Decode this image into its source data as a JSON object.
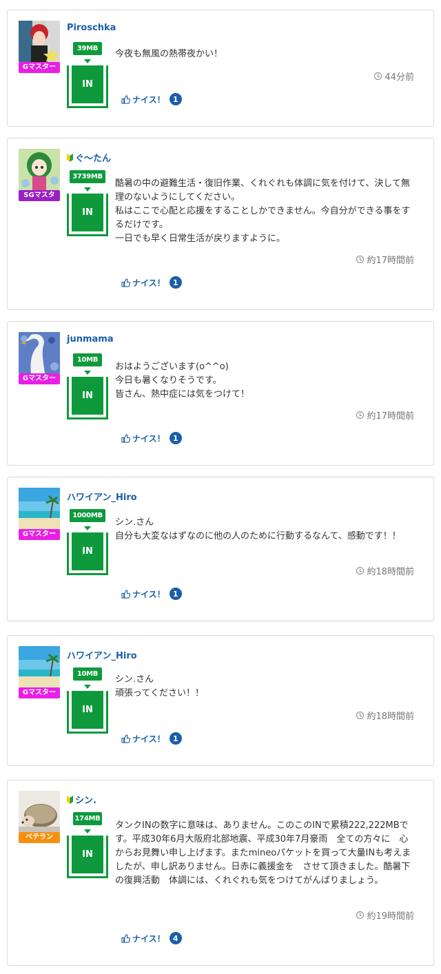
{
  "colors": {
    "tank_green": "#0e9a3c",
    "link_blue": "#1a5fa8",
    "rank_gmaster": "#e91fe6",
    "rank_sgmaster": "#9b1fc4",
    "rank_veteran": "#f5900f"
  },
  "posts": [
    {
      "user": "Piroschka",
      "beginner_mark": false,
      "rank": "Gマスター",
      "tank_amount": "39MB",
      "tank_label": "IN",
      "text": "今夜も無風の熱帯夜かい！",
      "time": "44分前",
      "nice_label": "ナイス！",
      "nice_count": "1"
    },
    {
      "user": "ぐ〜たん",
      "beginner_mark": true,
      "rank": "SGマスタ",
      "tank_amount": "3739MB",
      "tank_label": "IN",
      "text": "酷暑の中の避難生活・復旧作業、くれぐれも体調に気を付けて、決して無理のないようにしてください。\n私はここで心配と応援をすることしかできません。今自分ができる事をするだけです。\n一日でも早く日常生活が戻りますように。",
      "time": "約17時間前",
      "nice_label": "ナイス！",
      "nice_count": "1"
    },
    {
      "user": "junmama",
      "beginner_mark": false,
      "rank": "Gマスター",
      "tank_amount": "10MB",
      "tank_label": "IN",
      "text": "おはようございます(o^^o)\n今日も暑くなりそうです。\n皆さん、熱中症には気をつけて！",
      "time": "約17時間前",
      "nice_label": "ナイス！",
      "nice_count": "1"
    },
    {
      "user": "ハワイアン_Hiro",
      "beginner_mark": false,
      "rank": "Gマスター",
      "tank_amount": "1000MB",
      "tank_label": "IN",
      "text": "シン.さん\n自分も大変なはずなのに他の人のために行動するなんて、感動です！！",
      "time": "約18時間前",
      "nice_label": "ナイス！",
      "nice_count": "1"
    },
    {
      "user": "ハワイアン_Hiro",
      "beginner_mark": false,
      "rank": "Gマスター",
      "tank_amount": "10MB",
      "tank_label": "IN",
      "text": "シン.さん\n頑張ってください！！",
      "time": "約18時間前",
      "nice_label": "ナイス！",
      "nice_count": "1"
    },
    {
      "user": "シン.",
      "beginner_mark": true,
      "rank": "ベテラン",
      "tank_amount": "174MB",
      "tank_label": "IN",
      "text": "タンクINの数字に意味は、ありません。このこのINで累積222,222MBです。平成30年6月大阪府北部地震、平成30年7月豪雨　全ての方々に　心からお見舞い申し上げます。またmineoパケットを買って大量INも考えましたが、申し訳ありません。日赤に義援金を　させて頂きました。酷暑下の復興活動　体調には、くれぐれも気をつけてがんばりましょう。",
      "time": "約19時間前",
      "nice_label": "ナイス！",
      "nice_count": "4"
    }
  ]
}
